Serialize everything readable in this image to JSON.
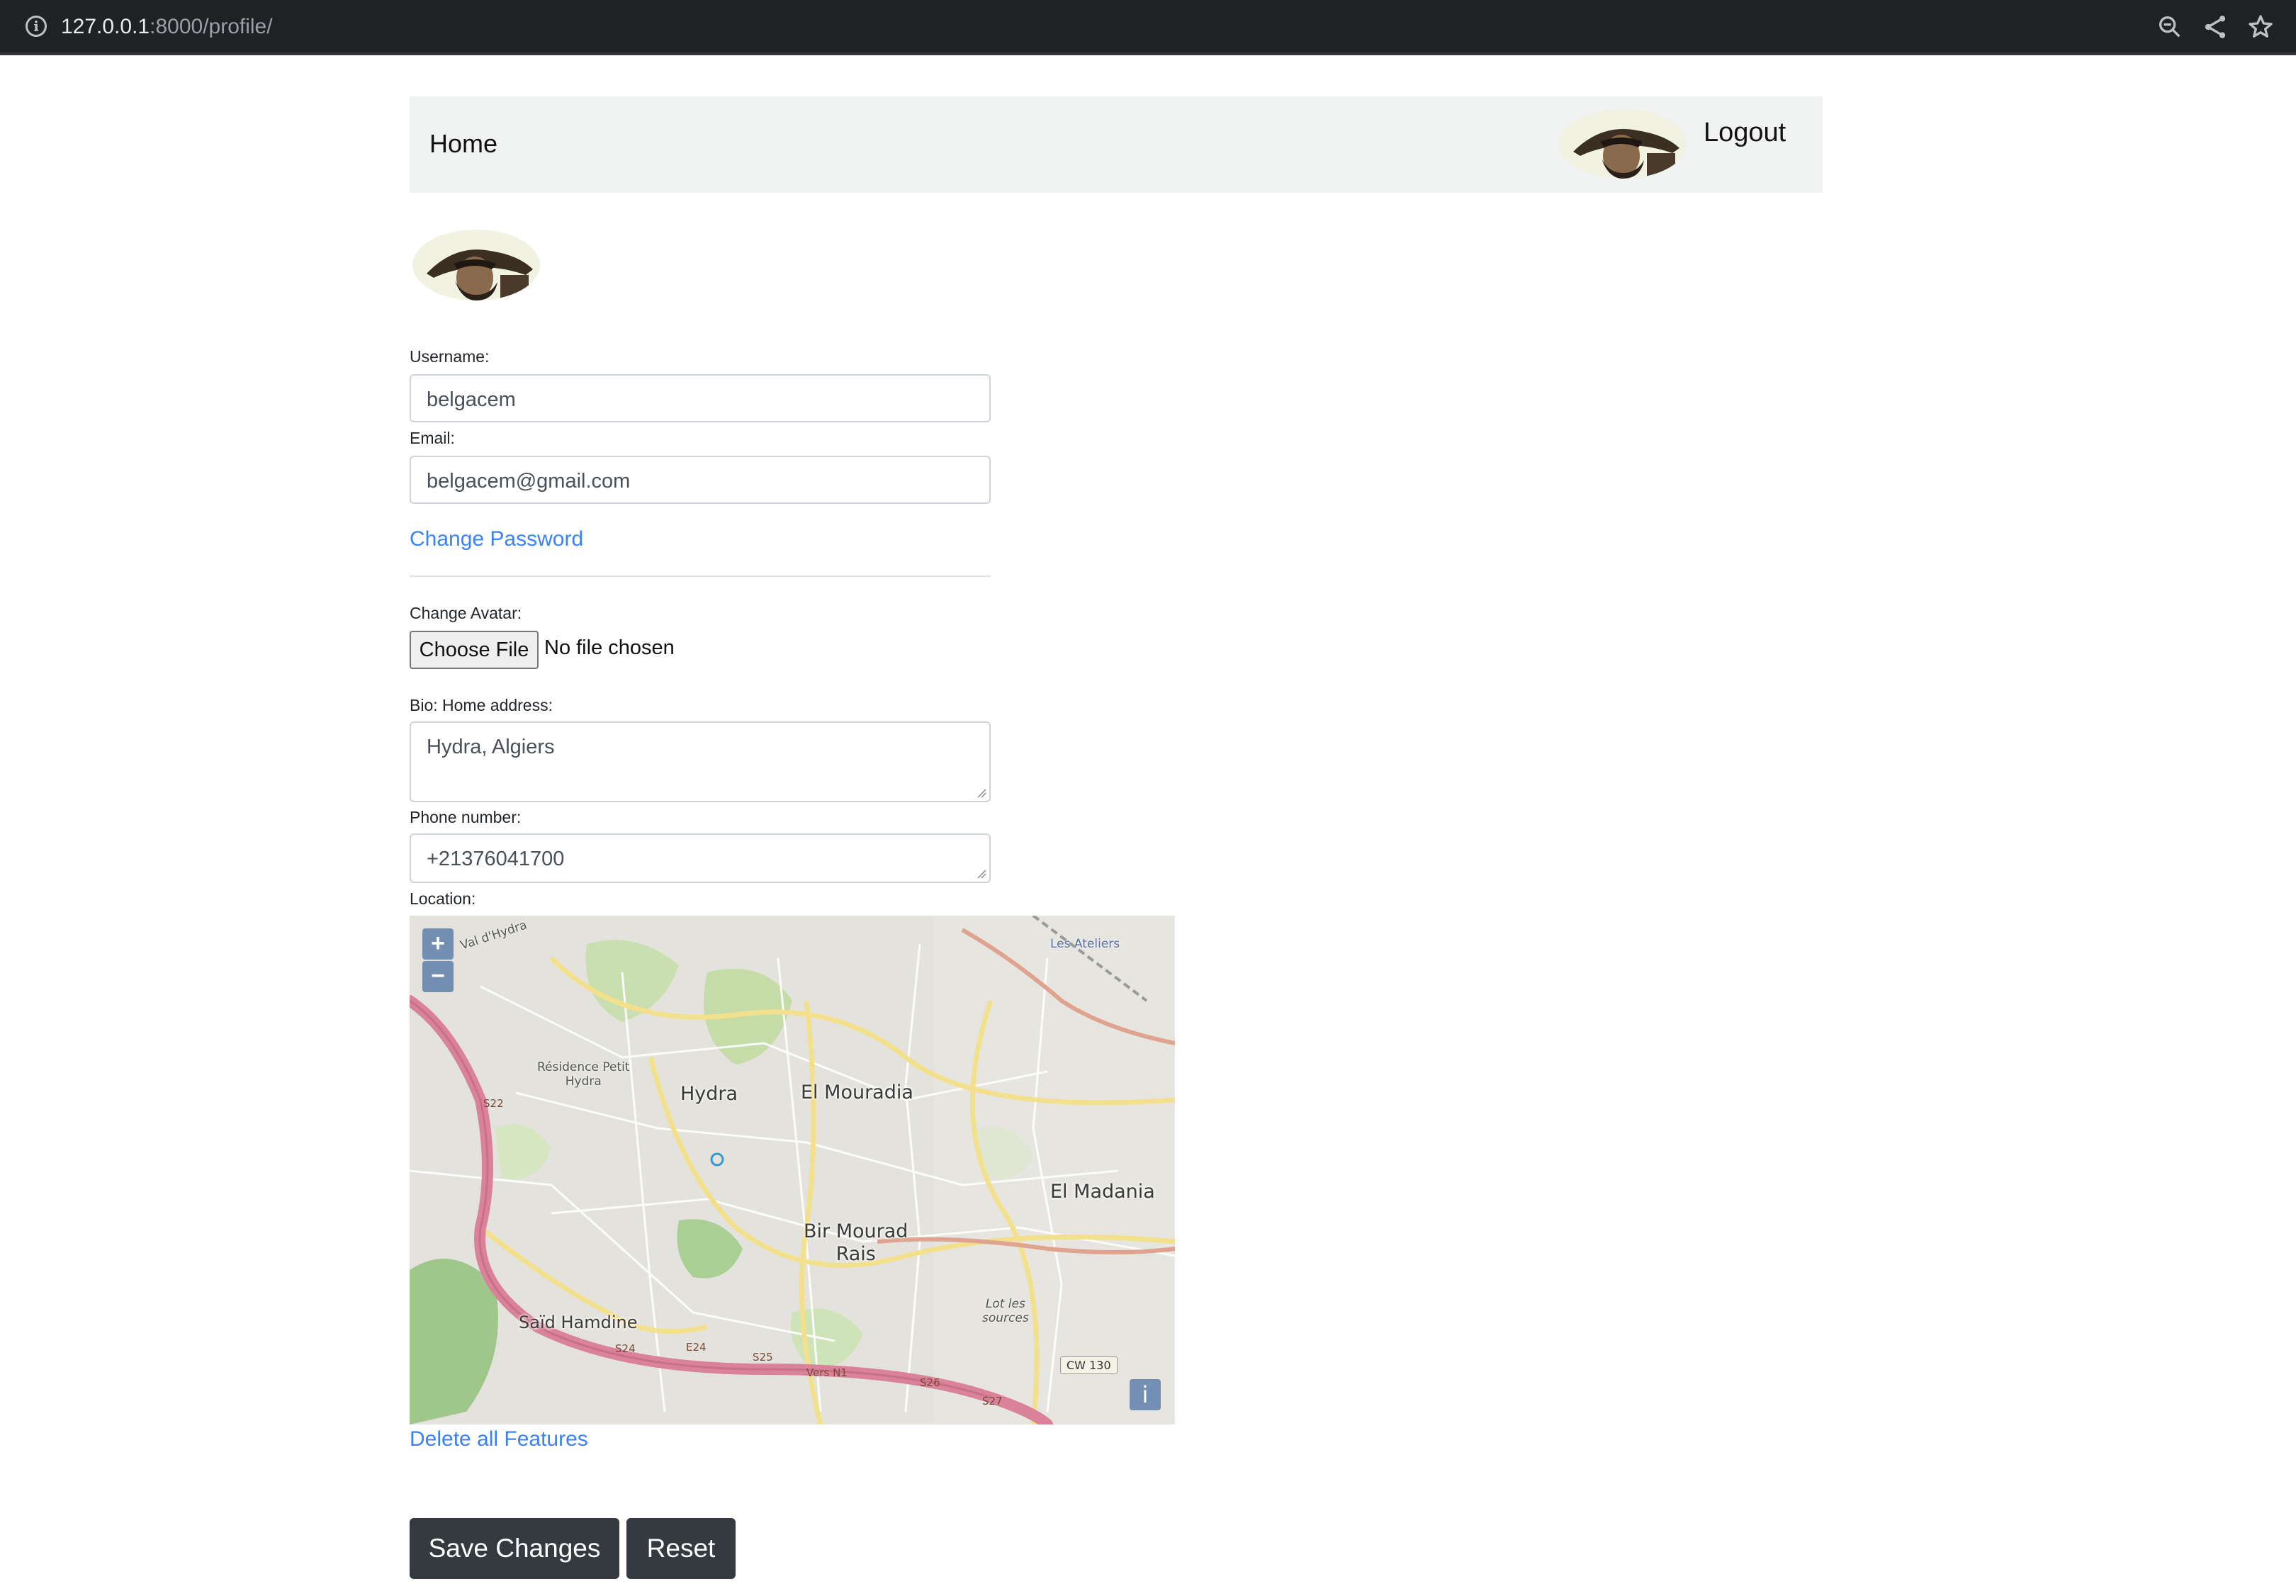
{
  "browser": {
    "url_host": "127.0.0.1",
    "url_rest": ":8000/profile/"
  },
  "navbar": {
    "home_label": "Home",
    "logout_label": "Logout"
  },
  "form": {
    "username_label": "Username:",
    "username_value": "belgacem",
    "email_label": "Email:",
    "email_value": "belgacem@gmail.com",
    "change_password_link": "Change Password",
    "avatar_label": "Change Avatar:",
    "choose_file_label": "Choose File",
    "no_file_text": "No file chosen",
    "bio_label": "Bio:",
    "address_label": "Home address:",
    "address_value": "Hydra, Algiers",
    "phone_label": "Phone number:",
    "phone_value": "+21376041700",
    "location_label": "Location:",
    "delete_features_link": "Delete all Features",
    "save_button": "Save Changes",
    "reset_button": "Reset"
  },
  "map": {
    "zoom_in": "+",
    "zoom_out": "−",
    "info": "i",
    "places": {
      "hydra": "Hydra",
      "el_mouradia": "El Mouradia",
      "el_madania": "El Madania",
      "bir_mourad_rais": "Bir Mourad",
      "bir_mourad_rais_2": "Rais",
      "said_hamdine": "Saïd Hamdine",
      "residence_1": "Résidence Petit",
      "residence_2": "Hydra",
      "ateliers": "Les Ateliers",
      "lot_1": "Lot les",
      "lot_2": "sources",
      "val_hydra": "Val d'Hydra"
    },
    "roads": {
      "s22": "S22",
      "s24": "S24",
      "e24": "E24",
      "s25": "S25",
      "s26": "S26",
      "s27": "S27",
      "vers_n1": "Vers N1",
      "cw130": "CW 130"
    }
  }
}
